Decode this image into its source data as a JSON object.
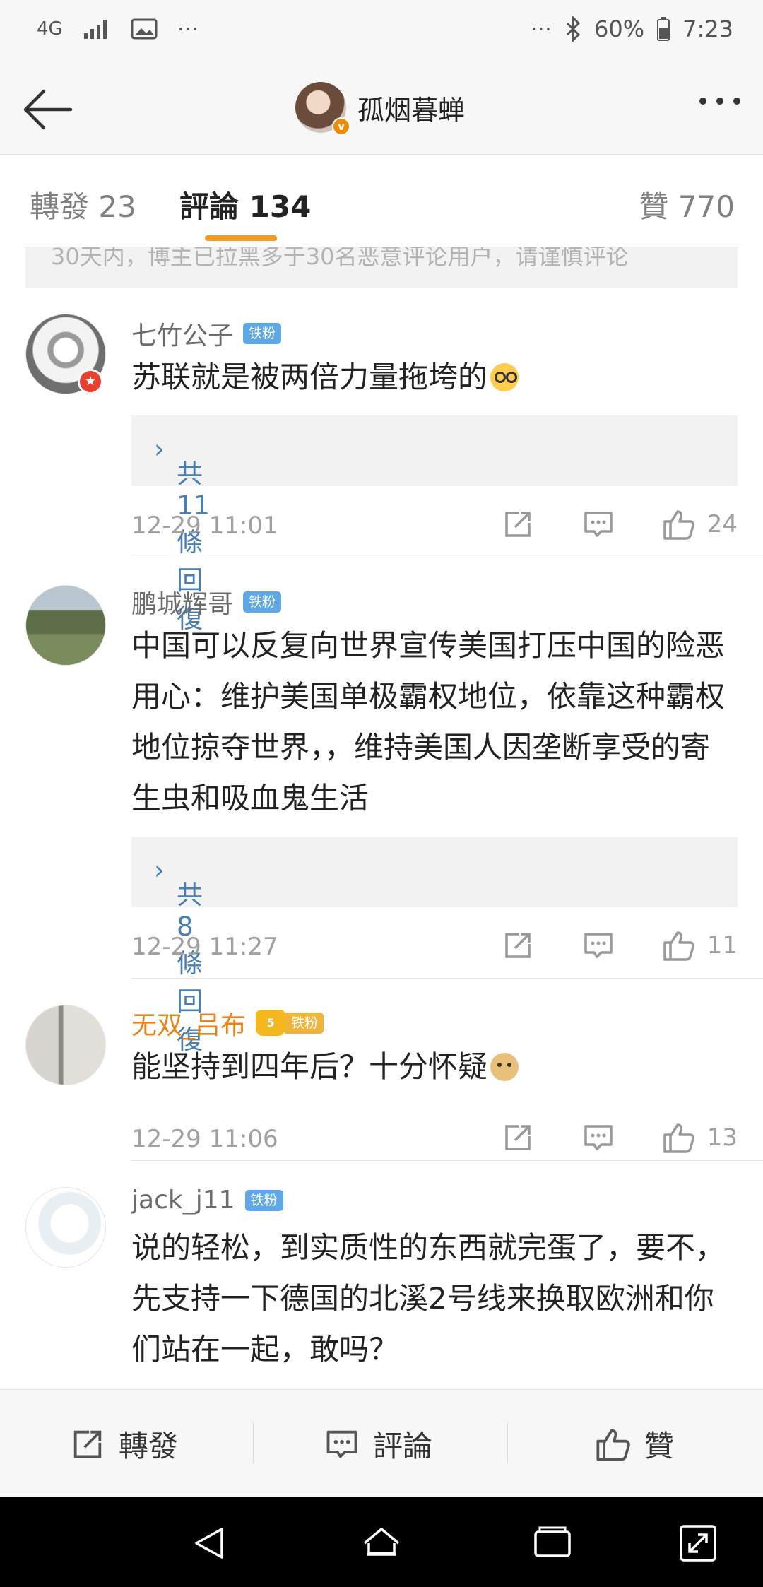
{
  "status_bar": {
    "network": "4G",
    "dots_left": "···",
    "dots_right": "···",
    "battery": "60%",
    "time": "7:23"
  },
  "header": {
    "title": "孤烟暮蝉"
  },
  "tabs": [
    {
      "label": "轉發 23"
    },
    {
      "label": "評論 134"
    },
    {
      "label": "贊 770"
    }
  ],
  "notice": "30天内，博主已拉黑多于30名恶意评论用户，请谨慎评论",
  "comments": [
    {
      "name": "七竹公子",
      "badge": "铁粉",
      "text": "苏联就是被两倍力量拖垮的",
      "replies": "共11條回復",
      "time": "12-29 11:01",
      "likes": "24"
    },
    {
      "name": "鹏城辉哥",
      "badge": "铁粉",
      "text": "中国可以反复向世界宣传美国打压中国的险恶用心：维护美国单极霸权地位，依靠这种霸权地位掠夺世界，，维持美国人因垄断享受的寄生虫和吸血鬼生活",
      "replies": "共8條回復",
      "time": "12-29 11:27",
      "likes": "11"
    },
    {
      "name": "无双_吕布",
      "badge": "铁粉",
      "crown_level": "5",
      "text": "能坚持到四年后？十分怀疑",
      "time": "12-29 11:06",
      "likes": "13"
    },
    {
      "name": "jack_j11",
      "badge": "铁粉",
      "text": "说的轻松，到实质性的东西就完蛋了，要不，先支持一下德国的北溪2号线来换取欧洲和你们站在一起，敢吗？"
    }
  ],
  "bottom_bar": {
    "repost": "轉發",
    "comment": "評論",
    "like": "贊"
  },
  "icons": {
    "back": "back-arrow-icon",
    "share": "share-icon",
    "comment": "comment-icon",
    "like": "thumbs-up-icon"
  }
}
